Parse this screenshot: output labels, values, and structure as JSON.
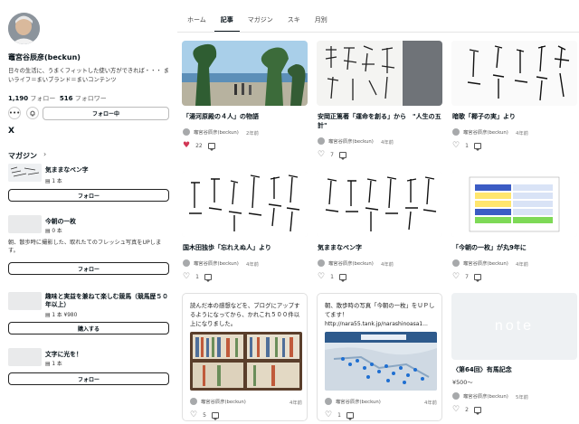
{
  "profile": {
    "name": "竈宮谷辰彦(beckun)",
    "bio": "日々の生活に、うまくフィットした使い方ができれば・・・ まいライフ＝まいブランド＝まいコンテンツ",
    "followers_count": "1,190",
    "followers_label": "フォロー",
    "following_count": "516",
    "following_label": "フォロワー",
    "more_icon": "•••",
    "notify_icon": "bell-plus-icon",
    "following_button": "フォロー中",
    "x_icon": "X"
  },
  "magazine": {
    "heading": "マガジン",
    "chevron": "›",
    "items": [
      {
        "title": "気ままなペン字",
        "count": "1 本",
        "description": "",
        "price": "",
        "button": "フォロー"
      },
      {
        "title": "今朝の一枚",
        "count": "0 本",
        "description": "朝、散歩時に撮影した、取れたてのフレッシュ写真をUPします。",
        "price": "",
        "button": "フォロー"
      },
      {
        "title": "趣味と実益を兼ねて楽しむ競馬（競馬歴５０年以上）",
        "count": "1 本",
        "description": "",
        "price": "¥980",
        "button": "購入する"
      },
      {
        "title": "文字に光を！",
        "count": "1 本",
        "description": "",
        "price": "",
        "button": "フォロー"
      }
    ]
  },
  "nav": {
    "tabs": [
      "ホーム",
      "記事",
      "マガジン",
      "スキ",
      "月別"
    ],
    "active_index": 1
  },
  "cards": [
    {
      "title": "「湯河原殿の４人」の物語",
      "author": "竈宮谷辰彦(beckun)",
      "date": "2年前",
      "likes": "22",
      "liked": true,
      "comments": ""
    },
    {
      "title": "安岡正篤著「運命を創る」から　\"人生の五計\"",
      "author": "竈宮谷辰彦(beckun)",
      "date": "4年前",
      "likes": "7",
      "liked": false,
      "comments": ""
    },
    {
      "title": "暗歌「椰子の実」より",
      "author": "竈宮谷辰彦(beckun)",
      "date": "4年前",
      "likes": "1",
      "liked": false,
      "comments": ""
    },
    {
      "title": "国木田独歩「忘れえぬ人」より",
      "author": "竈宮谷辰彦(beckun)",
      "date": "4年前",
      "likes": "1",
      "liked": false,
      "comments": ""
    },
    {
      "title": "気ままなペン字",
      "author": "竈宮谷辰彦(beckun)",
      "date": "4年前",
      "likes": "1",
      "liked": false,
      "comments": ""
    },
    {
      "title": "「今朝の一枚」が丸9年に",
      "author": "竈宮谷辰彦(beckun)",
      "date": "4年前",
      "likes": "7",
      "liked": false,
      "comments": ""
    },
    {
      "text": "読んだ本の感想などを、ブログにアップするようになってから、かれこれ５００件以上になりました。",
      "author": "竈宮谷辰彦(beckun)",
      "date": "4年前",
      "likes": "5",
      "liked": false,
      "comments": ""
    },
    {
      "text": "朝、散歩時の写真「今朝の一枚」をＵＰしてます！",
      "link": "http://nara55.tank.jp/narashinoasa1...",
      "author": "竈宮谷辰彦(beckun)",
      "date": "4年前",
      "likes": "1",
      "liked": false,
      "comments": ""
    },
    {
      "title": "〈第64回〉有馬記念",
      "price": "¥500〜",
      "logo": "note",
      "author": "竈宮谷辰彦(beckun)",
      "date": "5年前",
      "likes": "2",
      "liked": false,
      "comments": ""
    }
  ],
  "colors": {
    "accent": "#08131a",
    "heart": "#d23755",
    "border": "#e0e0e0"
  }
}
